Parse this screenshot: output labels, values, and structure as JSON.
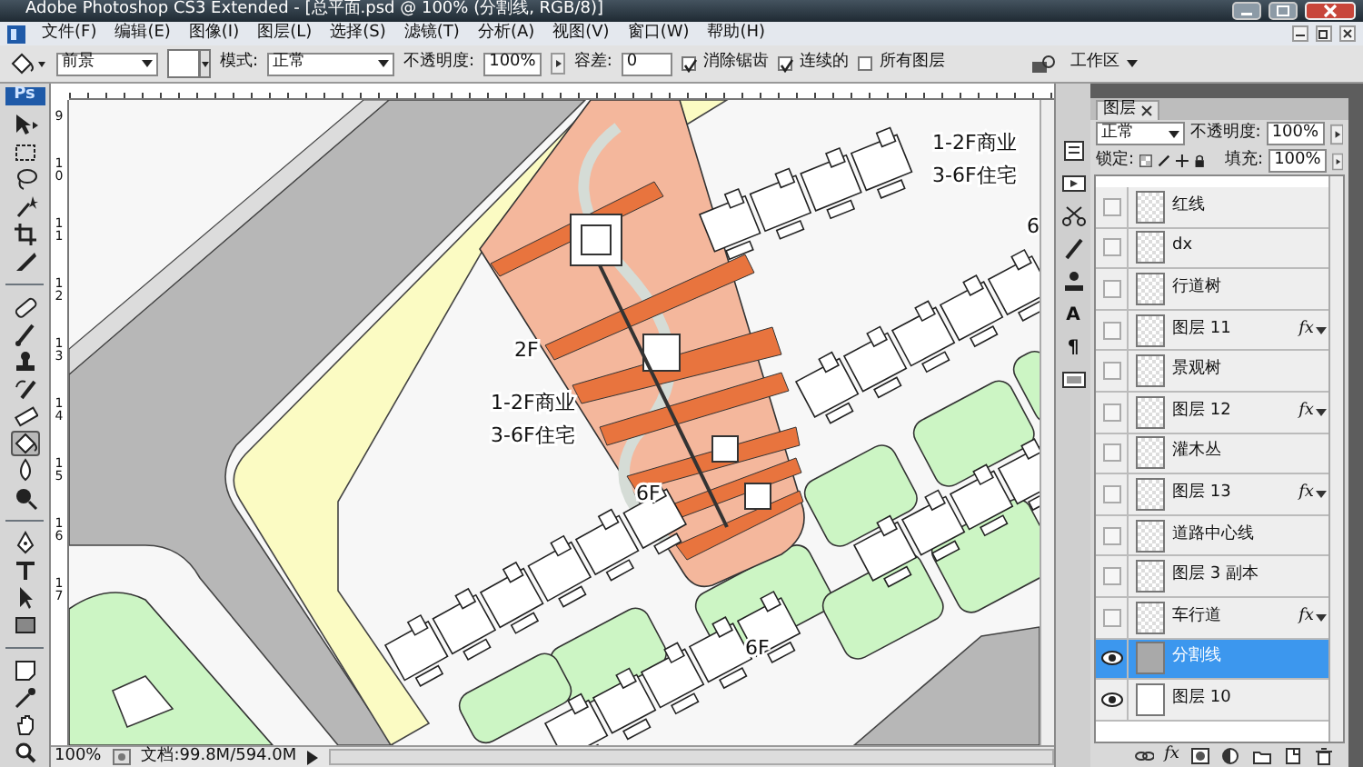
{
  "window": {
    "title": "Adobe Photoshop CS3 Extended - [总平面.psd @ 100% (分割线, RGB/8)]"
  },
  "menu": [
    "文件(F)",
    "编辑(E)",
    "图像(I)",
    "图层(L)",
    "选择(S)",
    "滤镜(T)",
    "分析(A)",
    "视图(V)",
    "窗口(W)",
    "帮助(H)"
  ],
  "options_bar": {
    "fill_source": "前景",
    "mode_label": "模式:",
    "mode": "正常",
    "opacity_label": "不透明度:",
    "opacity": "100%",
    "tolerance_label": "容差:",
    "tolerance": "0",
    "checkboxes": [
      {
        "label": "消除锯齿",
        "checked": true
      },
      {
        "label": "连续的",
        "checked": true
      },
      {
        "label": "所有图层",
        "checked": false
      }
    ],
    "workspace": "工作区"
  },
  "toolbox": {
    "logo": "Ps",
    "tools": [
      {
        "kind": "move",
        "selected": false
      },
      {
        "kind": "marquee",
        "selected": false
      },
      {
        "kind": "lasso",
        "selected": false
      },
      {
        "kind": "wand",
        "selected": false
      },
      {
        "kind": "crop",
        "selected": false
      },
      {
        "kind": "slice",
        "selected": false
      },
      {
        "kind": "healing",
        "selected": false
      },
      {
        "kind": "brush",
        "selected": false
      },
      {
        "kind": "stamp",
        "selected": false
      },
      {
        "kind": "history",
        "selected": false
      },
      {
        "kind": "eraser",
        "selected": false
      },
      {
        "kind": "bucket",
        "selected": true
      },
      {
        "kind": "blur",
        "selected": false
      },
      {
        "kind": "dodge",
        "selected": false
      },
      {
        "kind": "pen",
        "selected": false
      },
      {
        "kind": "type",
        "selected": false
      },
      {
        "kind": "path",
        "selected": false
      },
      {
        "kind": "shape",
        "selected": false
      },
      {
        "kind": "notes",
        "selected": false
      },
      {
        "kind": "eyedropper",
        "selected": false
      },
      {
        "kind": "hand",
        "selected": false
      },
      {
        "kind": "zoom",
        "selected": false
      }
    ]
  },
  "rulers": {
    "vertical_labels": [
      "9",
      "10",
      "11",
      "12",
      "13",
      "14",
      "15",
      "16",
      "17"
    ]
  },
  "canvas": {
    "labels": [
      "1-2F商业",
      "3-6F住宅",
      "6",
      "2F",
      "1-2F商业",
      "3-6F住宅",
      "6F",
      "6F"
    ]
  },
  "status_bar": {
    "zoom": "100%",
    "doc_size": "文档:99.8M/594.0M"
  },
  "dock": [
    {
      "kind": "history"
    },
    {
      "kind": "actions"
    },
    {
      "kind": "tools"
    },
    {
      "kind": "brushes"
    },
    {
      "kind": "clone"
    },
    {
      "kind": "glyph",
      "glyph": "A"
    },
    {
      "kind": "glyph",
      "glyph": "¶"
    },
    {
      "kind": "layers"
    }
  ],
  "layers_panel": {
    "tab": "图层",
    "blend_mode": "正常",
    "opacity_label": "不透明度:",
    "opacity": "100%",
    "lock_label": "锁定:",
    "fill_label": "填充:",
    "fill": "100%",
    "layers": [
      {
        "name": "红线",
        "visible": false,
        "selected": false,
        "kind": "transparent"
      },
      {
        "name": "dx",
        "visible": false,
        "selected": false,
        "kind": "transparent"
      },
      {
        "name": "行道树",
        "visible": false,
        "selected": false,
        "kind": "transparent"
      },
      {
        "name": "图层 11",
        "visible": false,
        "selected": false,
        "kind": "transparent",
        "effects": "fx"
      },
      {
        "name": "景观树",
        "visible": false,
        "selected": false,
        "kind": "transparent"
      },
      {
        "name": "图层 12",
        "visible": false,
        "selected": false,
        "kind": "transparent",
        "effects": "fx"
      },
      {
        "name": "灌木丛",
        "visible": false,
        "selected": false,
        "kind": "transparent"
      },
      {
        "name": "图层 13",
        "visible": false,
        "selected": false,
        "kind": "transparent",
        "effects": "fx"
      },
      {
        "name": "道路中心线",
        "visible": false,
        "selected": false,
        "kind": "transparent"
      },
      {
        "name": "图层 3 副本",
        "visible": false,
        "selected": false,
        "kind": "transparent"
      },
      {
        "name": "车行道",
        "visible": false,
        "selected": false,
        "kind": "transparent",
        "effects": "fx"
      },
      {
        "name": "分割线",
        "visible": true,
        "selected": true,
        "kind": "gray"
      },
      {
        "name": "图层 10",
        "visible": true,
        "selected": false,
        "kind": "white"
      }
    ],
    "footer_buttons": [
      {
        "kind": "link"
      },
      {
        "kind": "glyph",
        "glyph": "fx"
      },
      {
        "kind": "mask"
      },
      {
        "kind": "adjust"
      },
      {
        "kind": "folder"
      },
      {
        "kind": "new"
      },
      {
        "kind": "trash"
      }
    ]
  }
}
